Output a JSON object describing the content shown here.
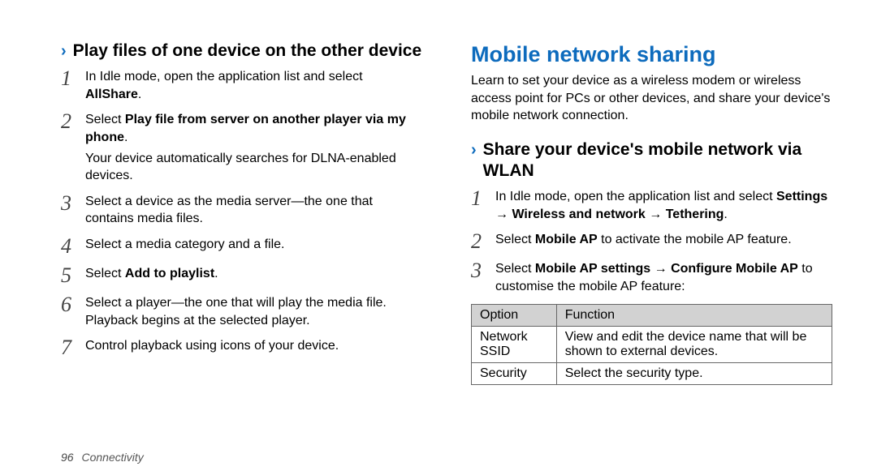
{
  "left": {
    "subheading": "Play files of one device on the other device",
    "steps": [
      {
        "html": "In Idle mode, open the application list and select <b>AllShare</b>."
      },
      {
        "html": "Select <b>Play file from server on another player via my phone</b>.",
        "follow": "Your device automatically searches for DLNA-enabled devices."
      },
      {
        "html": "Select a device as the media server—the one that contains media files."
      },
      {
        "html": "Select a media category and a file."
      },
      {
        "html": "Select <b>Add to playlist</b>."
      },
      {
        "html": "Select a player—the one that will play the media file. Playback begins at the selected player."
      },
      {
        "html": "Control playback using icons of your device."
      }
    ]
  },
  "right": {
    "title": "Mobile network sharing",
    "intro": "Learn to set your device as a wireless modem or wireless access point for PCs or other devices, and share your device's mobile network connection.",
    "subheading": "Share your device's mobile network via WLAN",
    "steps": [
      {
        "html": "In Idle mode, open the application list and select <b>Settings</b> → <b>Wireless and network</b> → <b>Tethering</b>."
      },
      {
        "html": "Select <b>Mobile AP</b> to activate the mobile AP feature."
      },
      {
        "html": "Select <b>Mobile AP settings</b> → <b>Configure Mobile AP</b> to customise the mobile AP feature:"
      }
    ],
    "table": {
      "headers": [
        "Option",
        "Function"
      ],
      "rows": [
        [
          "Network SSID",
          "View and edit the device name that will be shown to external devices."
        ],
        [
          "Security",
          "Select the security type."
        ]
      ]
    }
  },
  "footer": {
    "page": "96",
    "section": "Connectivity"
  }
}
